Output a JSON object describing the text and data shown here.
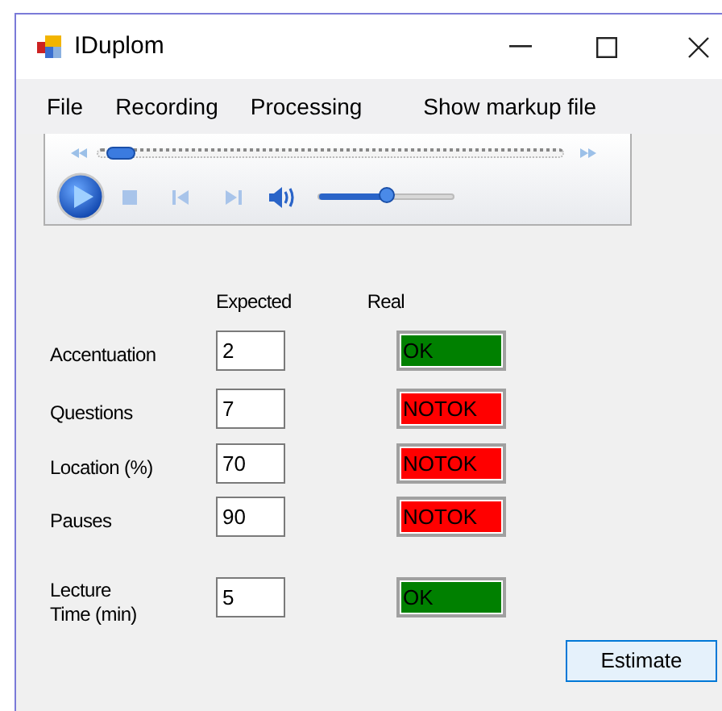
{
  "window": {
    "title": "IDuplom"
  },
  "menu": [
    "File",
    "Recording",
    "Processing",
    "Show markup file"
  ],
  "player": {
    "seek": {
      "level": 0.02
    },
    "volume": {
      "level": 0.5
    }
  },
  "columns": {
    "expected": "Expected",
    "real": "Real"
  },
  "rows": [
    {
      "label": "Accentuation",
      "expected": "2",
      "result": {
        "kind": "ok",
        "text": "OK"
      }
    },
    {
      "label": "Questions",
      "expected": "7",
      "result": {
        "kind": "notok",
        "text": "NOTOK"
      }
    },
    {
      "label": "Location (%)",
      "expected": "70",
      "result": {
        "kind": "notok",
        "text": "NOTOK"
      }
    },
    {
      "label": "Pauses",
      "expected": "90",
      "result": {
        "kind": "notok",
        "text": "NOTOK"
      }
    },
    {
      "label": "Lecture\nTime (min)",
      "expected": "5",
      "result": {
        "kind": "ok",
        "text": "OK"
      }
    }
  ],
  "estimate_button": "Estimate"
}
